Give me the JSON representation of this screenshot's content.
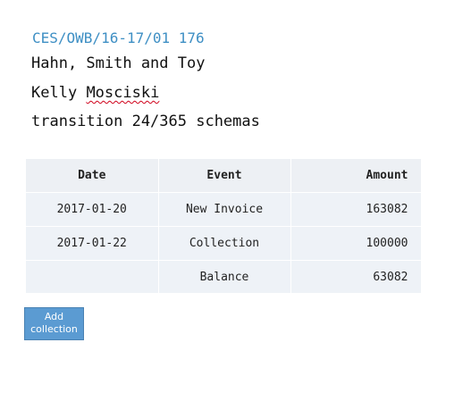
{
  "header": {
    "reference": "CES/OWB/16-17/01 176",
    "company": "Hahn, Smith and Toy",
    "contact_first": "Kelly",
    "contact_last": "Mosciski",
    "subject": "transition 24/365 schemas"
  },
  "table": {
    "columns": [
      "Date",
      "Event",
      "Amount"
    ],
    "rows": [
      {
        "date": "2017-01-20",
        "event": "New Invoice",
        "amount": "163082"
      },
      {
        "date": "2017-01-22",
        "event": "Collection",
        "amount": "100000"
      },
      {
        "date": "",
        "event": "Balance",
        "amount": "63082"
      }
    ]
  },
  "actions": {
    "add_collection_line1": "Add",
    "add_collection_line2": "collection"
  },
  "colors": {
    "reference_text": "#3e8fc4",
    "table_background": "#eef2f7",
    "button_background": "#5b9bd2"
  }
}
